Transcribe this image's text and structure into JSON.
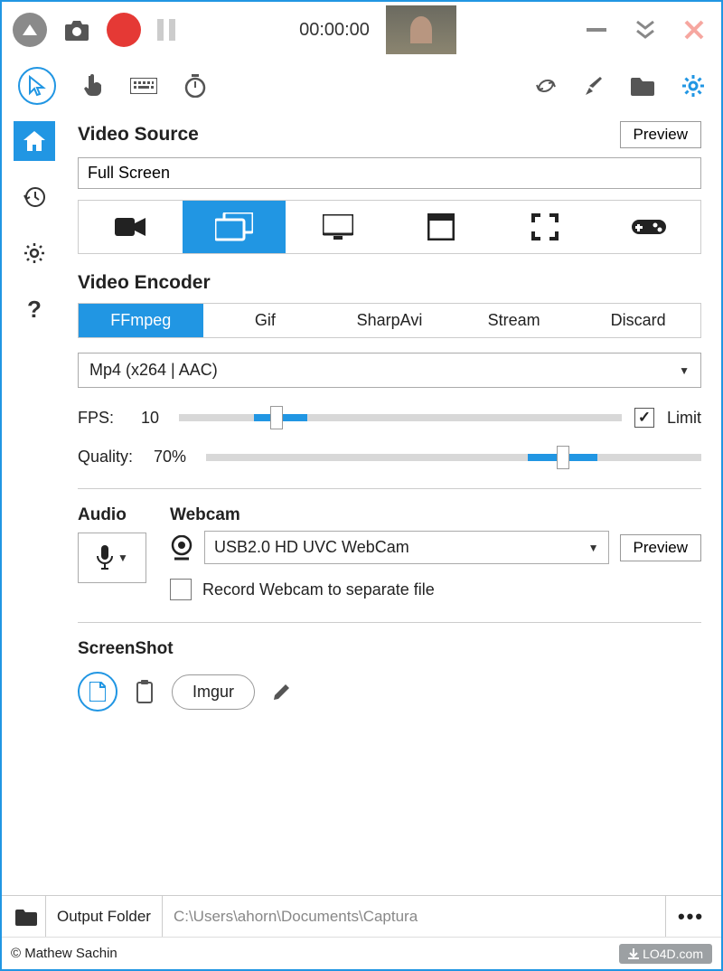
{
  "titlebar": {
    "timer": "00:00:00"
  },
  "videoSource": {
    "title": "Video Source",
    "previewBtn": "Preview",
    "value": "Full Screen"
  },
  "encoder": {
    "title": "Video Encoder",
    "tabs": [
      "FFmpeg",
      "Gif",
      "SharpAvi",
      "Stream",
      "Discard"
    ],
    "format": "Mp4 (x264 | AAC)"
  },
  "fps": {
    "label": "FPS:",
    "value": "10",
    "limitLabel": "Limit",
    "limitChecked": true,
    "percent": 20
  },
  "quality": {
    "label": "Quality:",
    "value": "70%",
    "percent": 70
  },
  "audio": {
    "title": "Audio"
  },
  "webcam": {
    "title": "Webcam",
    "device": "USB2.0 HD UVC WebCam",
    "previewBtn": "Preview",
    "separateLabel": "Record Webcam to separate file"
  },
  "screenshot": {
    "title": "ScreenShot",
    "imgur": "Imgur"
  },
  "bottom": {
    "label": "Output Folder",
    "path": "C:\\Users\\ahorn\\Documents\\Captura"
  },
  "footer": {
    "copyright": "© Mathew Sachin",
    "brand": "LO4D.com"
  }
}
